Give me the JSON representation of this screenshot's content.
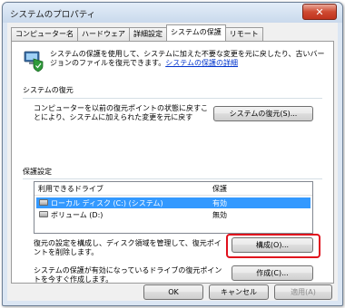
{
  "window": {
    "title": "システムのプロパティ"
  },
  "tabs": [
    "コンピューター名",
    "ハードウェア",
    "詳細設定",
    "システムの保護",
    "リモート"
  ],
  "active_tab": "システムの保護",
  "intro": {
    "text": "システムの保護を使用して、システムに加えた不要な変更を元に戻したり、古いバージョンのファイルを復元できます。",
    "link": "システムの保護の詳細"
  },
  "restore_section": {
    "title": "システムの復元",
    "text": "コンピューターを以前の復元ポイントの状態に戻すことにより、システムに加えられた変更を元に戻す",
    "button": "システムの復元(S)..."
  },
  "protection_section": {
    "title": "保護設定",
    "columns": [
      "利用できるドライブ",
      "保護"
    ],
    "drives": [
      {
        "name": "ローカル ディスク (C:) (システム)",
        "protection": "有効",
        "selected": true
      },
      {
        "name": "ボリューム (D:)",
        "protection": "無効",
        "selected": false
      }
    ],
    "configure_text": "復元の設定を構成し、ディスク領域を管理して、復元ポイントを削除します。",
    "configure_button": "構成(O)...",
    "create_text": "システムの保護が有効になっているドライブの復元ポイントを今すぐ作成します。",
    "create_button": "作成(C)..."
  },
  "footer": {
    "ok": "OK",
    "cancel": "キャンセル",
    "apply": "適用(A)"
  },
  "colors": {
    "selection": "#3399ff",
    "link": "#0033cc",
    "highlight": "#e0101c"
  }
}
